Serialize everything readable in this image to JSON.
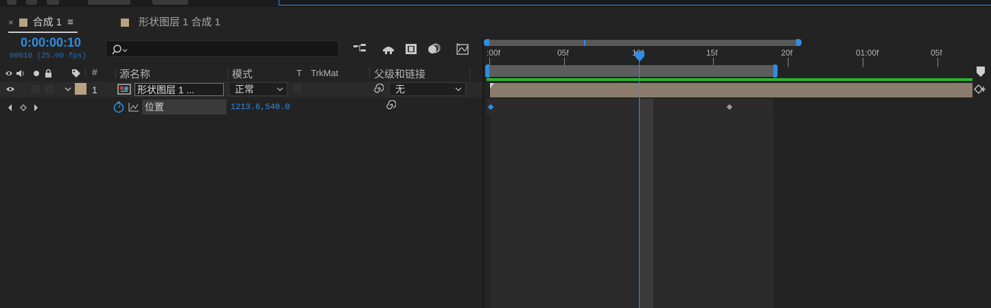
{
  "tabs": [
    {
      "label": "合成 1",
      "menu": "≡",
      "close": "×"
    },
    {
      "label": "形状图层 1 合成 1"
    }
  ],
  "timecode": "0:00:00:10",
  "frames_info": "00010 (25.00 fps)",
  "search": {
    "placeholder": "",
    "icon": "search-icon"
  },
  "columns": {
    "number": "#",
    "source_name": "源名称",
    "mode": "模式",
    "t": "T",
    "trkmat": "TrkMat",
    "parent": "父级和链接"
  },
  "layer": {
    "index": "1",
    "name": "形状图层 1 ...",
    "mode": "正常",
    "parent": "无",
    "label_color": "#b8a27f"
  },
  "property": {
    "name": "位置",
    "value": "1213.6,540.0"
  },
  "ruler": {
    "labels": [
      ":00f",
      "05f",
      "10f",
      "15f",
      "20f",
      "01:00f",
      "05f"
    ],
    "current_frame": 10
  },
  "colors": {
    "accent": "#2e8de6",
    "work_area": "#2ab52e",
    "layer_bar": "#8b7d6b"
  },
  "keyframes": [
    {
      "frame": 0,
      "selected": true
    },
    {
      "frame": 16,
      "selected": false
    }
  ]
}
